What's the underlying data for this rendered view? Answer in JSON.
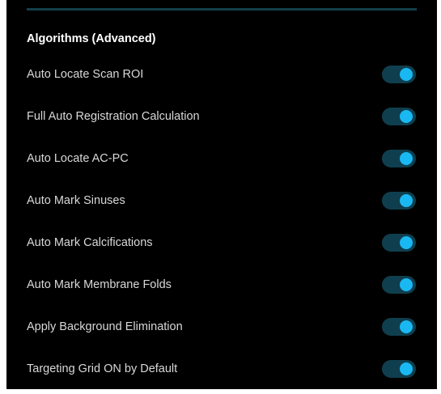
{
  "section": {
    "title": "Algorithms (Advanced)"
  },
  "colors": {
    "panel_background": "#000000",
    "toggle_track_on": "#0f3f4e",
    "toggle_knob_on": "#1ab8f3",
    "divider": "#12404a"
  },
  "settings": [
    {
      "label": "Auto Locate Scan ROI",
      "enabled": true
    },
    {
      "label": "Full Auto Registration Calculation",
      "enabled": true
    },
    {
      "label": "Auto Locate AC-PC",
      "enabled": true
    },
    {
      "label": "Auto Mark Sinuses",
      "enabled": true
    },
    {
      "label": "Auto Mark Calcifications",
      "enabled": true
    },
    {
      "label": "Auto Mark Membrane Folds",
      "enabled": true
    },
    {
      "label": "Apply Background Elimination",
      "enabled": true
    },
    {
      "label": "Targeting Grid ON by Default",
      "enabled": true
    }
  ]
}
